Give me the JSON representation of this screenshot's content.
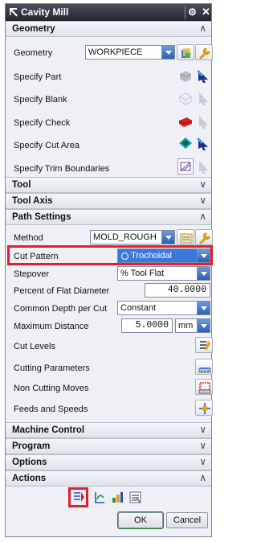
{
  "window": {
    "title": "Cavity Mill"
  },
  "sections": {
    "geometry": "Geometry",
    "tool": "Tool",
    "tool_axis": "Tool Axis",
    "path_settings": "Path Settings",
    "machine_control": "Machine Control",
    "program": "Program",
    "options": "Options",
    "actions": "Actions"
  },
  "geometry": {
    "geometry_label": "Geometry",
    "geometry_value": "WORKPIECE",
    "specify_part": "Specify Part",
    "specify_blank": "Specify Blank",
    "specify_check": "Specify Check",
    "specify_cut_area": "Specify Cut Area",
    "specify_trim": "Specify Trim Boundaries"
  },
  "path": {
    "method_label": "Method",
    "method_value": "MOLD_ROUGH",
    "cut_pattern_label": "Cut Pattern",
    "cut_pattern_value": "Trochoidal",
    "stepover_label": "Stepover",
    "stepover_value": "% Tool Flat",
    "percent_label": "Percent of Flat Diameter",
    "percent_value": "40.0000",
    "depth_label": "Common Depth per Cut",
    "depth_value": "Constant",
    "max_distance_label": "Maximum Distance",
    "max_distance_value": "5.0000",
    "max_distance_unit": "mm",
    "cut_levels": "Cut Levels",
    "cutting_params": "Cutting Parameters",
    "non_cutting": "Non Cutting Moves",
    "feeds_speeds": "Feeds and Speeds"
  },
  "buttons": {
    "ok": "OK",
    "cancel": "Cancel"
  },
  "icons": {
    "title": "cam-window-icon",
    "gear": "gear-icon",
    "close": "close-icon"
  }
}
